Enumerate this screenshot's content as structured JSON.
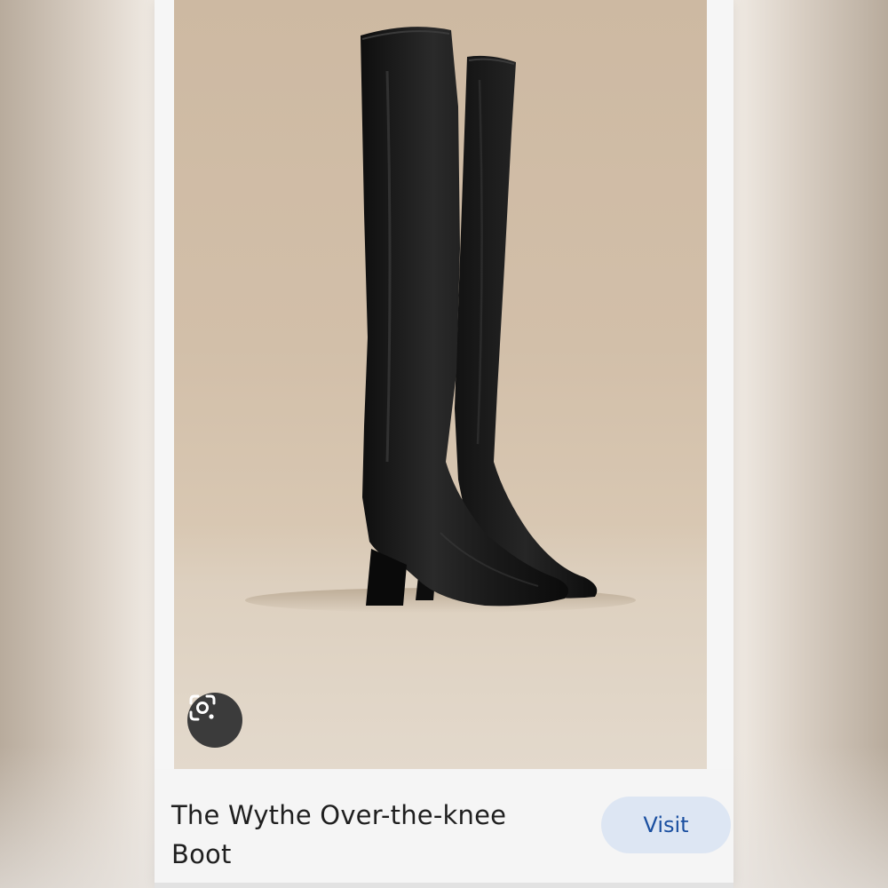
{
  "result": {
    "title": "The Wythe Over-the-knee Boot",
    "visit_label": "Visit"
  },
  "image": {
    "subject": "black leather over-the-knee boots on beige backdrop"
  },
  "icons": {
    "lens": "google-lens-icon"
  },
  "colors": {
    "visit_bg": "#dde6f3",
    "visit_text": "#1a4fa0",
    "backdrop": "#cdb9a2",
    "boot": "#141414"
  }
}
